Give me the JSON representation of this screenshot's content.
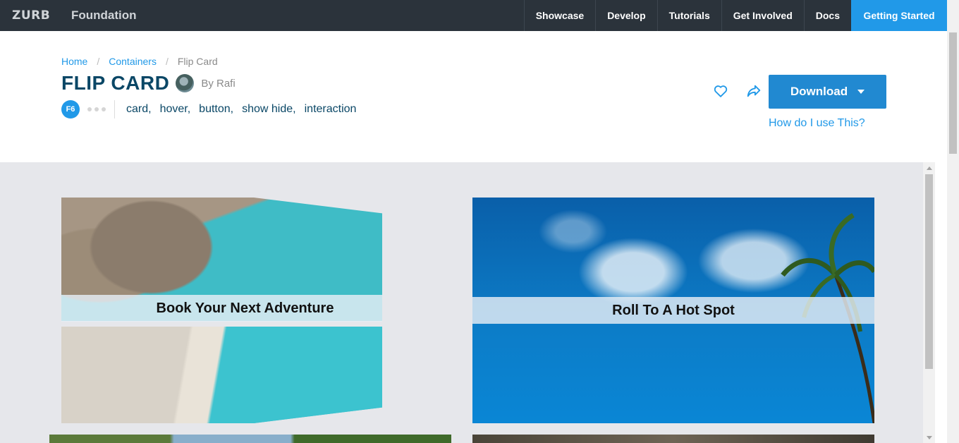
{
  "topbar": {
    "logo_mark": "ZURB",
    "logo_text": "Foundation",
    "nav": [
      "Showcase",
      "Develop",
      "Tutorials",
      "Get Involved",
      "Docs"
    ],
    "cta": "Getting Started"
  },
  "breadcrumb": {
    "home": "Home",
    "section": "Containers",
    "current": "Flip Card",
    "separator": "/"
  },
  "header": {
    "title": "FLIP CARD",
    "author": "By Rafi",
    "badge": "F6",
    "tags": [
      "card,",
      "hover,",
      "button,",
      "show hide,",
      "interaction"
    ],
    "download_label": "Download",
    "help_label": "How do I use This?"
  },
  "cards": {
    "first_label": "Book Your Next Adventure",
    "second_label": "Roll To A Hot Spot"
  },
  "colors": {
    "topbar": "#2b333b",
    "accent": "#2199e8",
    "title": "#0a4766",
    "content_bg": "#e6e7eb"
  },
  "icons": [
    "heart-icon",
    "share-icon",
    "chevron-down-icon",
    "avatar"
  ]
}
